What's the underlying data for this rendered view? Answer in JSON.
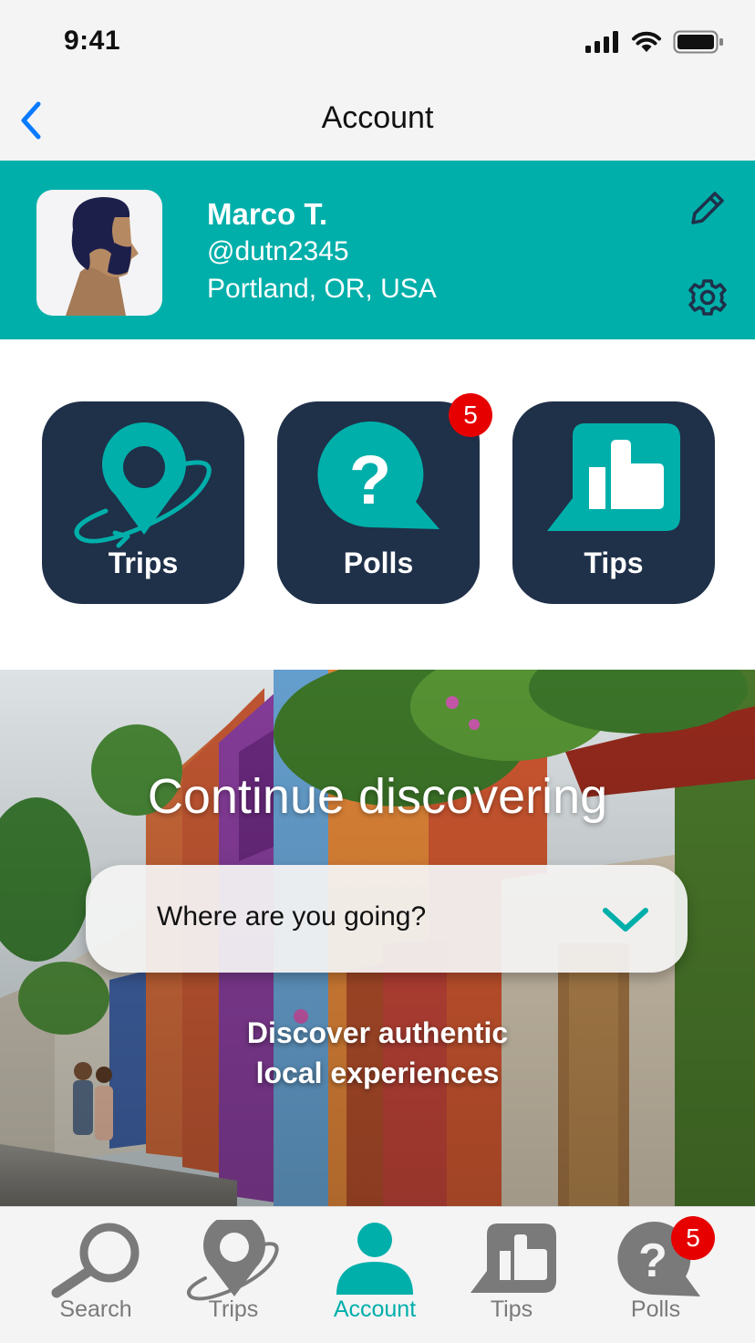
{
  "status_bar": {
    "time": "9:41"
  },
  "nav": {
    "title": "Account"
  },
  "profile": {
    "name": "Marco T.",
    "handle": "@dutn2345",
    "location": "Portland, OR, USA"
  },
  "tiles": [
    {
      "label": "Trips",
      "icon": "planet-pin-icon"
    },
    {
      "label": "Polls",
      "icon": "question-bubble-icon",
      "badge": "5"
    },
    {
      "label": "Tips",
      "icon": "thumbs-up-bubble-icon"
    }
  ],
  "hero": {
    "title": "Continue discovering",
    "select_placeholder": "Where are you going?",
    "subtitle_line1": "Discover authentic",
    "subtitle_line2": "local experiences"
  },
  "tab_bar": {
    "items": [
      {
        "label": "Search",
        "icon": "search-icon"
      },
      {
        "label": "Trips",
        "icon": "planet-pin-icon"
      },
      {
        "label": "Account",
        "icon": "person-icon",
        "active": true
      },
      {
        "label": "Tips",
        "icon": "thumbs-up-bubble-icon"
      },
      {
        "label": "Polls",
        "icon": "question-bubble-icon",
        "badge": "5"
      }
    ]
  },
  "colors": {
    "accent": "#00afaa",
    "tile_bg": "#1f3049",
    "badge": "#e60000",
    "back_chevron": "#0a7aff",
    "tab_inactive": "#7a7a7a"
  }
}
